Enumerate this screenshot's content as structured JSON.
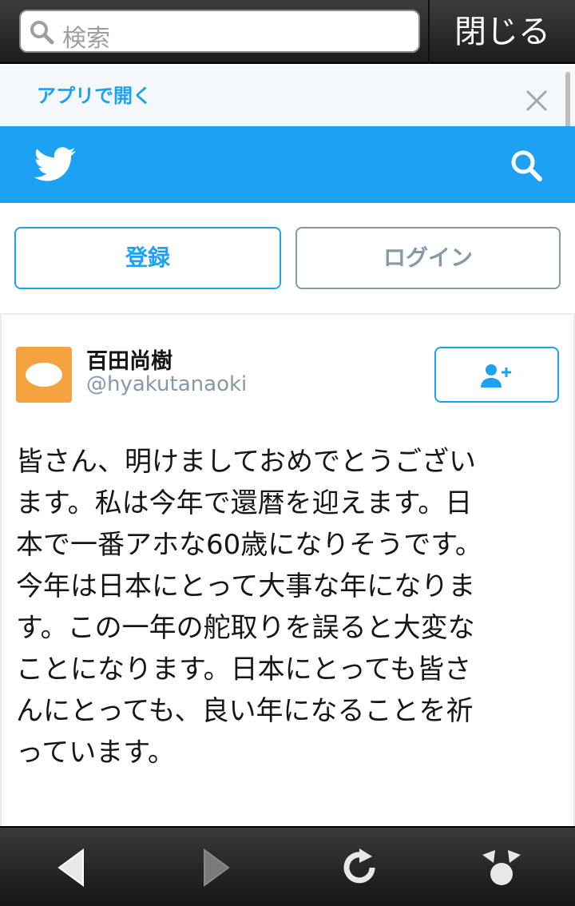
{
  "browser": {
    "search_placeholder": "検索",
    "close_label": "閉じる"
  },
  "app_banner": {
    "open_in_app": "アプリで開く"
  },
  "auth": {
    "register_label": "登録",
    "login_label": "ログイン"
  },
  "tweet": {
    "user_name": "百田尚樹",
    "user_handle": "@hyakutanaoki",
    "text": "皆さん、明けましておめでとうござい\nます。私は今年で還暦を迎えます。日\n本で一番アホな60歳になりそうです。\n今年は日本にとって大事な年になりま\nす。この一年の舵取りを誤ると大変な\nことになります。日本にとっても皆さ\nんにとっても、良い年になることを祈\nっています。"
  },
  "colors": {
    "accent": "#1da1f2",
    "muted": "#8899a6",
    "avatar_bg": "#f4a340"
  },
  "icons": {
    "search": "search-icon",
    "close": "close-icon",
    "bird": "twitter-bird-icon",
    "follow": "follow-user-icon",
    "back": "back-arrow-icon",
    "forward": "forward-arrow-icon",
    "refresh": "refresh-icon",
    "share": "share-icon"
  }
}
